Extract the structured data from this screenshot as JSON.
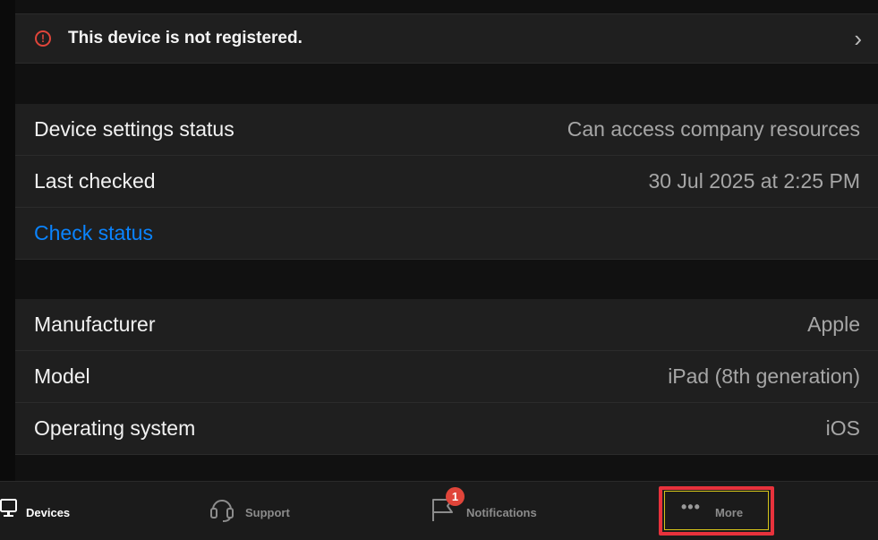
{
  "banner": {
    "text": "This device is not registered."
  },
  "status_section": {
    "rows": [
      {
        "label": "Device settings status",
        "value": "Can access company resources"
      },
      {
        "label": "Last checked",
        "value": "30 Jul 2025 at 2:25 PM"
      }
    ],
    "check_status_label": "Check status"
  },
  "device_section": {
    "rows": [
      {
        "label": "Manufacturer",
        "value": "Apple"
      },
      {
        "label": "Model",
        "value": "iPad (8th generation)"
      },
      {
        "label": "Operating system",
        "value": "iOS"
      }
    ]
  },
  "tabbar": {
    "tabs": [
      {
        "label": "Devices",
        "icon": "devices-icon",
        "active": true
      },
      {
        "label": "Support",
        "icon": "headset-icon",
        "active": false
      },
      {
        "label": "Notifications",
        "icon": "flag-icon",
        "active": false,
        "badge": "1"
      },
      {
        "label": "More",
        "icon": "ellipsis-icon",
        "active": false
      }
    ]
  },
  "colors": {
    "background": "#111111",
    "row": "#1f1f1f",
    "link": "#0a84ff",
    "warning": "#e0453a",
    "highlight": "#e8323c"
  }
}
